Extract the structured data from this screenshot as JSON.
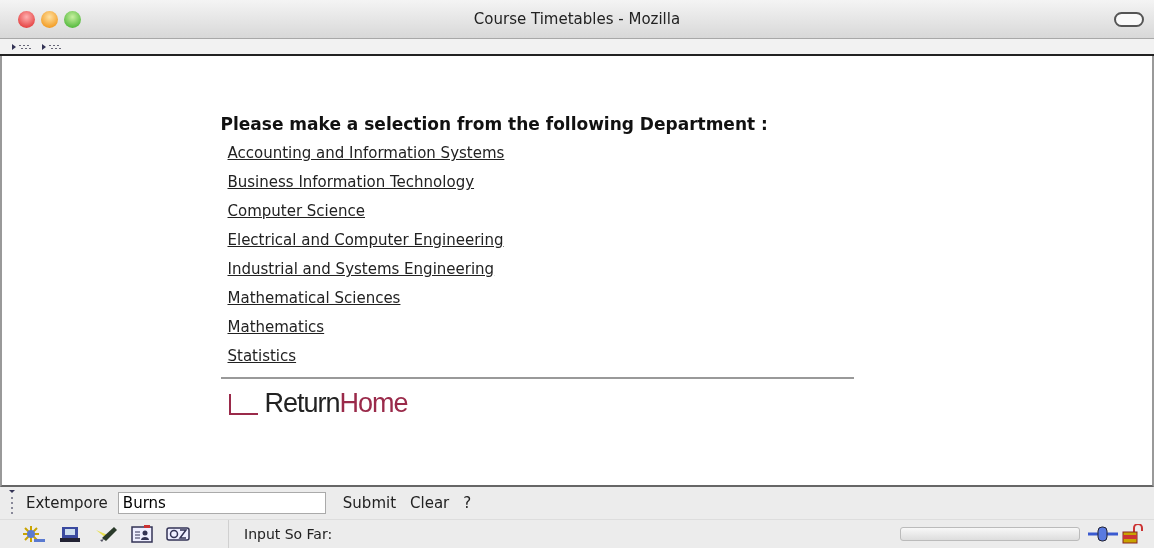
{
  "window": {
    "title": "Course Timetables - Mozilla"
  },
  "content": {
    "heading": "Please make a selection from the following Department :",
    "links": [
      "Accounting and Information Systems",
      "Business Information Technology",
      "Computer Science",
      "Electrical and Computer Engineering",
      "Industrial and Systems Engineering",
      "Mathematical Sciences",
      "Mathematics",
      "Statistics"
    ],
    "return_home": {
      "first": "Return",
      "second": "Home"
    }
  },
  "extempore_bar": {
    "label": "Extempore",
    "input": {
      "value": "Burns"
    },
    "buttons": [
      "Submit",
      "Clear",
      "?"
    ]
  },
  "status_bar": {
    "text": "Input So Far:",
    "progress": {
      "level": 0
    }
  }
}
